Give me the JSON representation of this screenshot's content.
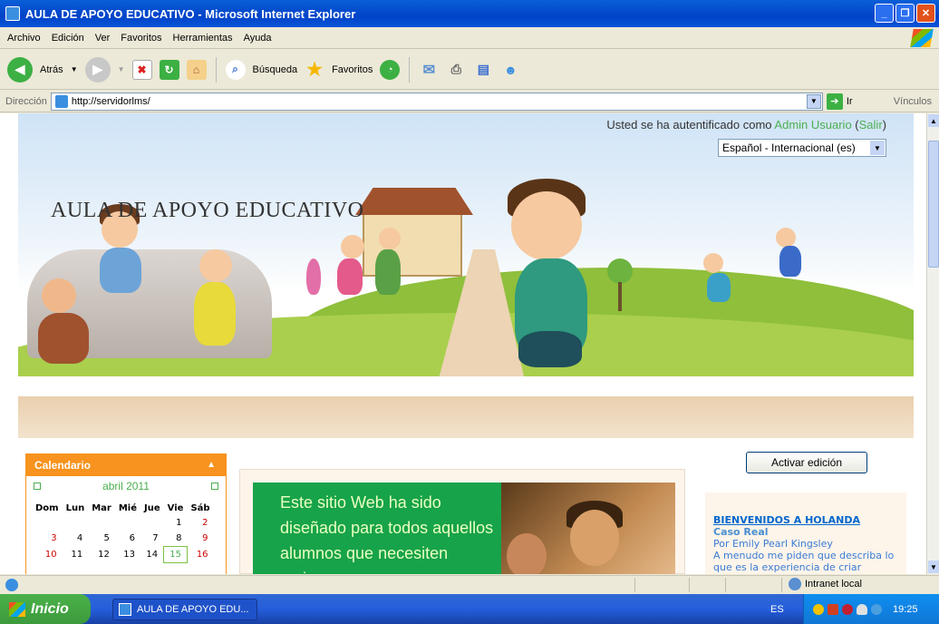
{
  "window": {
    "title": "AULA DE APOYO EDUCATIVO - Microsoft Internet Explorer"
  },
  "menu": [
    "Archivo",
    "Edición",
    "Ver",
    "Favoritos",
    "Herramientas",
    "Ayuda"
  ],
  "toolbar": {
    "back_label": "Atrás",
    "search_label": "Búsqueda",
    "favorites_label": "Favoritos"
  },
  "address": {
    "label": "Dirección",
    "url": "http://servidorlms/",
    "go_label": "Ir",
    "links_label": "Vínculos"
  },
  "page": {
    "login_prefix": "Usted se ha autentificado como",
    "user_name": "Admin Usuario",
    "logout_label": "Salir",
    "language": "Español - Internacional (es)",
    "banner_title": "AULA DE APOYO EDUCATIVO",
    "edit_button": "Activar edición"
  },
  "calendar": {
    "header": "Calendario",
    "month": "abril 2011",
    "weekdays": [
      "Dom",
      "Lun",
      "Mar",
      "Mié",
      "Jue",
      "Vie",
      "Sáb"
    ],
    "weeks": [
      [
        "",
        "",
        "",
        "",
        "",
        "1",
        "2"
      ],
      [
        "3",
        "4",
        "5",
        "6",
        "7",
        "8",
        "9"
      ],
      [
        "10",
        "11",
        "12",
        "13",
        "14",
        "15",
        "16"
      ]
    ],
    "today": "15"
  },
  "center": {
    "text": "Este sitio Web ha sido diseñado para todos aquellos alumnos que necesiten mejorar su"
  },
  "right_block": {
    "title": "BIENVENIDOS A HOLANDA",
    "subtitle": "Caso Real",
    "author": "Por Emily Pearl Kingsley",
    "excerpt": "A menudo me piden que describa lo que es la experiencia de criar"
  },
  "status": {
    "zone": "Intranet local"
  },
  "taskbar": {
    "start_label": "Inicio",
    "task_label": "AULA DE APOYO EDU...",
    "lang": "ES",
    "clock": "19:25"
  },
  "colors": {
    "accent_orange": "#f7931e",
    "link_green": "#4caf50",
    "content_green": "#17a34a"
  }
}
